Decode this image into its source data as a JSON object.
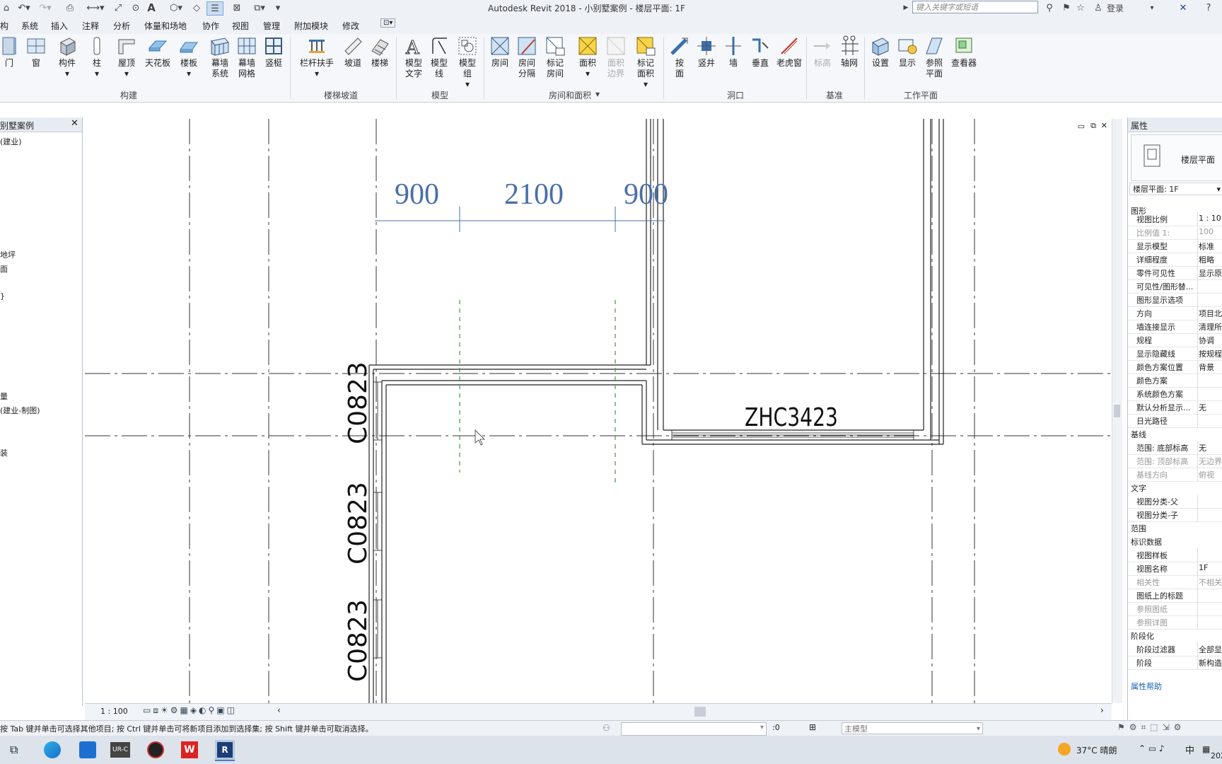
{
  "title": "Autodesk Revit 2018 -    小别墅案例 - 楼层平面: 1F",
  "search_placeholder": "键入关键字或短语",
  "login": "登录",
  "menu": [
    "构",
    "系统",
    "插入",
    "注释",
    "分析",
    "体量和场地",
    "协作",
    "视图",
    "管理",
    "附加模块",
    "修改"
  ],
  "ribbon": {
    "build": [
      "门",
      "窗",
      "构件",
      "柱",
      "屋顶",
      "天花板",
      "楼板",
      "幕墙系统",
      "幕墙网格",
      "竖梃"
    ],
    "stairs": [
      "栏杆扶手",
      "坡道",
      "楼梯"
    ],
    "model": [
      "模型文字",
      "模型线",
      "模型组"
    ],
    "room": [
      "房间",
      "房间分隔",
      "标记房间",
      "面积",
      "面积边界",
      "标记面积"
    ],
    "opening": [
      "按面",
      "竖井",
      "墙",
      "垂直",
      "老虎窗"
    ],
    "datum": [
      "标高",
      "轴网"
    ],
    "workplane": [
      "设置",
      "显示",
      "参照平面",
      "查看器"
    ],
    "groups": {
      "build": "构建",
      "stairs": "楼梯坡道",
      "model": "模型",
      "room": "房间和面积",
      "opening": "洞口",
      "datum": "基准",
      "workplane": "工作平面"
    }
  },
  "browser": {
    "title": "别墅案例",
    "items": [
      "(建业)",
      "地坪",
      "面",
      "}",
      "量",
      "(建业-制图)",
      "装"
    ]
  },
  "drawing": {
    "dims": [
      "900",
      "2100",
      "900"
    ],
    "tags": [
      "C0823",
      "C0823",
      "C0823",
      "ZHC3423"
    ]
  },
  "viewbar": {
    "scale": "1 : 100"
  },
  "status": {
    "hint": "按 Tab 键并单击可选择其他项目; 按 Ctrl 键并单击可将新项目添加到选择集; 按 Shift 键并单击可取消选择。",
    "count": ":0",
    "model": "主模型"
  },
  "props": {
    "title": "属性",
    "type_name": "楼层平面",
    "selector": "楼层平面: 1F",
    "sections": {
      "graphics": "图形",
      "underlay": "基线",
      "text": "文字",
      "extents": "范围",
      "identity": "标识数据",
      "phasing": "阶段化"
    },
    "rows_graphics": [
      [
        "视图比例",
        "1 : 10"
      ],
      [
        "比例值 1:",
        "100"
      ],
      [
        "显示模型",
        "标准"
      ],
      [
        "详细程度",
        "粗略"
      ],
      [
        "零件可见性",
        "显示原"
      ],
      [
        "可见性/图形替...",
        ""
      ],
      [
        "图形显示选项",
        ""
      ],
      [
        "方向",
        "项目北"
      ],
      [
        "墙连接显示",
        "清理所"
      ],
      [
        "规程",
        "协调"
      ],
      [
        "显示隐藏线",
        "按规程"
      ],
      [
        "颜色方案位置",
        "背景"
      ],
      [
        "颜色方案",
        ""
      ],
      [
        "系统颜色方案",
        ""
      ],
      [
        "默认分析显示...",
        "无"
      ],
      [
        "日光路径",
        ""
      ]
    ],
    "rows_underlay": [
      [
        "范围: 底部标高",
        "无"
      ],
      [
        "范围: 顶部标高",
        "无边界"
      ],
      [
        "基线方向",
        "俯视"
      ]
    ],
    "rows_text": [
      [
        "视图分类-父",
        ""
      ],
      [
        "视图分类-子",
        ""
      ]
    ],
    "rows_identity": [
      [
        "视图样板",
        ""
      ],
      [
        "视图名称",
        "1F"
      ],
      [
        "相关性",
        "不相关"
      ],
      [
        "图纸上的标题",
        ""
      ],
      [
        "参照图纸",
        ""
      ],
      [
        "参照详图",
        ""
      ]
    ],
    "rows_phasing": [
      [
        "阶段过滤器",
        "全部显"
      ],
      [
        "阶段",
        "新构造"
      ]
    ],
    "help": "属性帮助"
  },
  "taskbar": {
    "weather": "37°C 晴朗",
    "ime": "中",
    "year": "202"
  }
}
